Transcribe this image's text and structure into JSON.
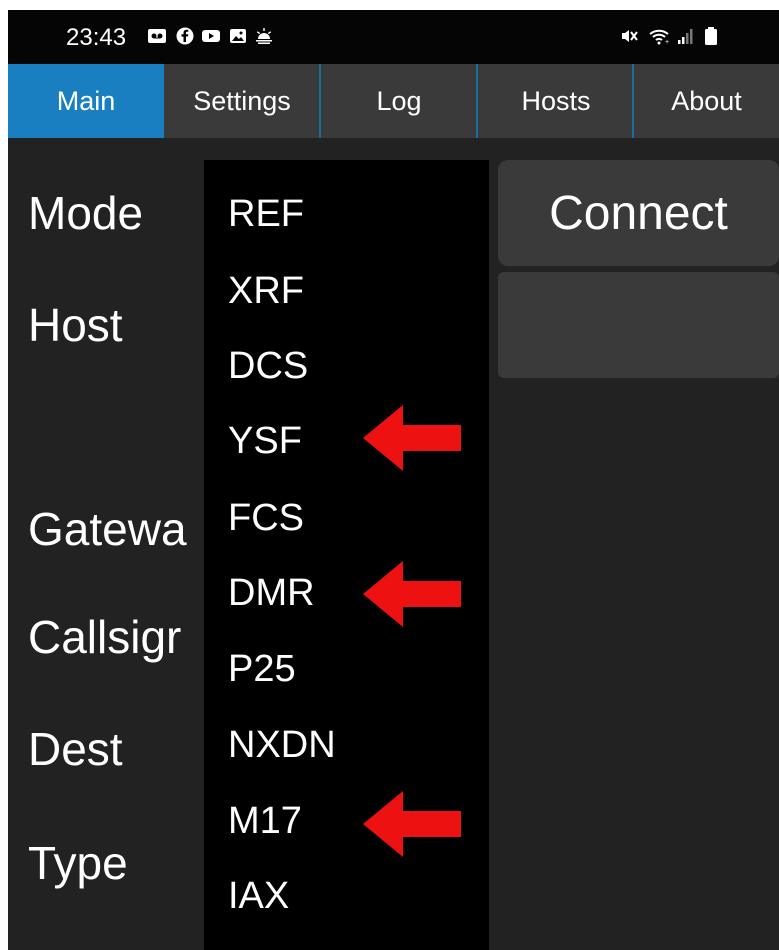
{
  "status_bar": {
    "time": "23:43",
    "left_icons": [
      "voicemail-icon",
      "facebook-icon",
      "youtube-icon",
      "gallery-icon",
      "weather-icon"
    ],
    "right_icons": [
      "mute-icon",
      "wifi-icon",
      "signal-icon",
      "battery-icon"
    ]
  },
  "tabs": [
    {
      "label": "Main",
      "active": true
    },
    {
      "label": "Settings",
      "active": false
    },
    {
      "label": "Log",
      "active": false
    },
    {
      "label": "Hosts",
      "active": false
    },
    {
      "label": "About",
      "active": false
    }
  ],
  "labels": {
    "mode": "Mode",
    "host": "Host",
    "gateway": "Gatewa",
    "callsign": "Callsigr",
    "dest": "Dest",
    "type": "Type"
  },
  "connect_button": "Connect",
  "mode_dropdown": {
    "options": [
      "REF",
      "XRF",
      "DCS",
      "YSF",
      "FCS",
      "DMR",
      "P25",
      "NXDN",
      "M17",
      "IAX"
    ],
    "highlighted_by_arrow": [
      "YSF",
      "DMR",
      "M17"
    ]
  },
  "colors": {
    "active_tab": "#1a7fc1",
    "arrow": "#ee1111",
    "background": "#222222",
    "dropdown": "#000000"
  }
}
